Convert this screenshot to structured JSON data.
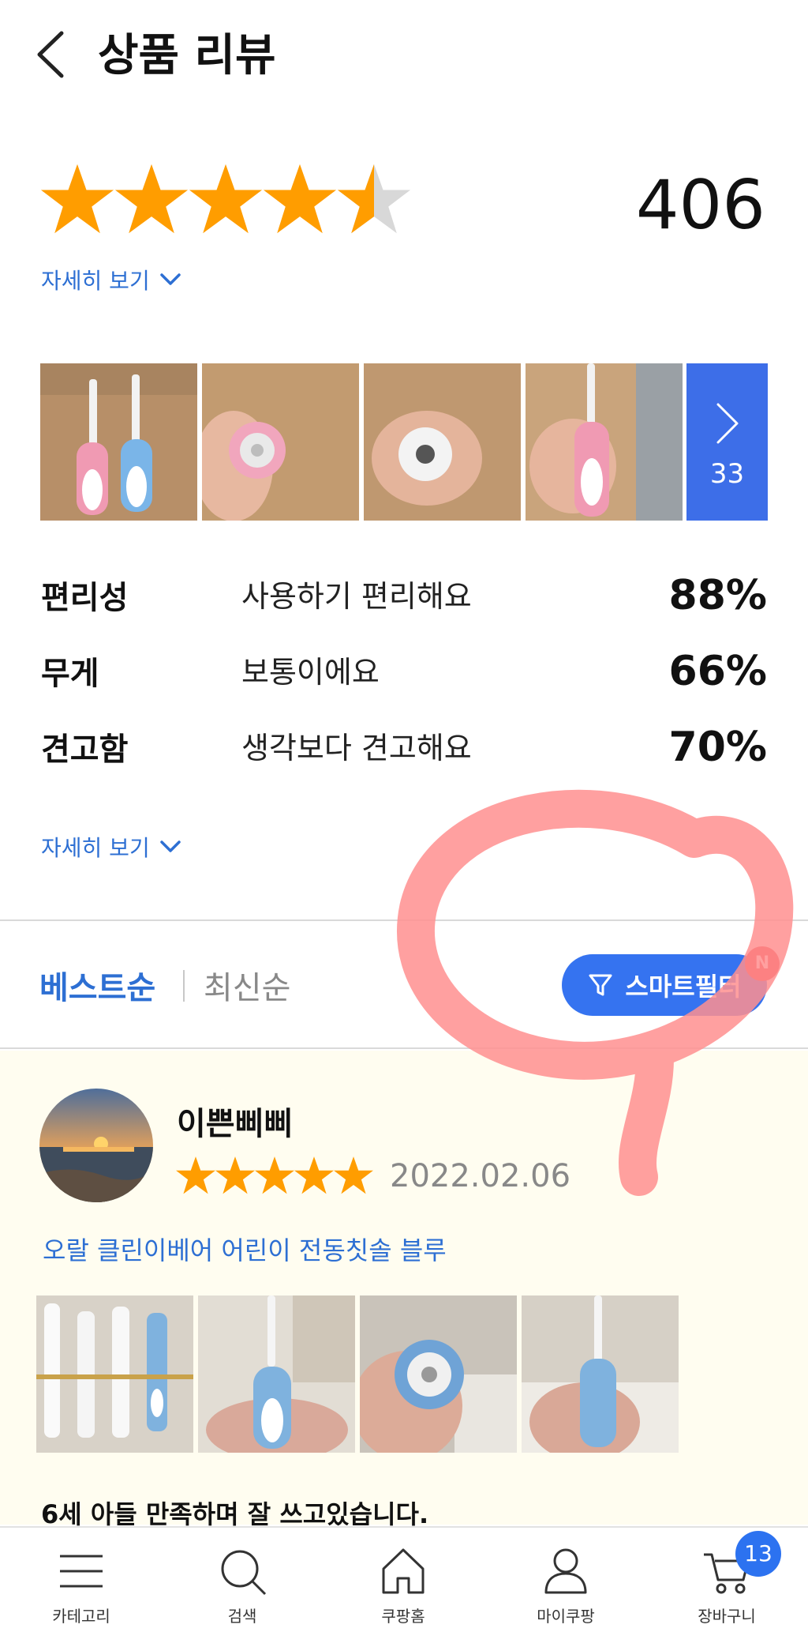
{
  "header": {
    "title": "상품 리뷰"
  },
  "rating": {
    "stars": 4.5,
    "max_stars": 5,
    "review_count": "406",
    "star_color": "#ff9d00"
  },
  "details_link": {
    "label": "자세히 보기"
  },
  "photo_strip": {
    "more_count": "33"
  },
  "attributes": [
    {
      "label": "편리성",
      "value": "사용하기 편리해요",
      "percent": "88%"
    },
    {
      "label": "무게",
      "value": "보통이에요",
      "percent": "66%"
    },
    {
      "label": "견고함",
      "value": "생각보다 견고해요",
      "percent": "70%"
    }
  ],
  "details_link_2": {
    "label": "자세히 보기"
  },
  "sort": {
    "best": "베스트순",
    "newest": "최신순",
    "smart_filter": "스마트필터",
    "new_badge": "N"
  },
  "review": {
    "reviewer": "이쁜삐삐",
    "stars": 5,
    "date": "2022.02.06",
    "product_option": "오랄 클린이베어 어린이 전동칫솔 블루",
    "text": "6세 아들 만족하며 잘 쓰고있습니다."
  },
  "bottom_nav": {
    "items": [
      {
        "label": "카테고리",
        "icon": "menu-icon"
      },
      {
        "label": "검색",
        "icon": "search-icon"
      },
      {
        "label": "쿠팡홈",
        "icon": "home-icon"
      },
      {
        "label": "마이쿠팡",
        "icon": "user-icon"
      },
      {
        "label": "장바구니",
        "icon": "cart-icon"
      }
    ],
    "cart_count": "13"
  },
  "colors": {
    "accent": "#3573f0",
    "link": "#2d6fd3",
    "annotation": "#ff8f8f"
  }
}
